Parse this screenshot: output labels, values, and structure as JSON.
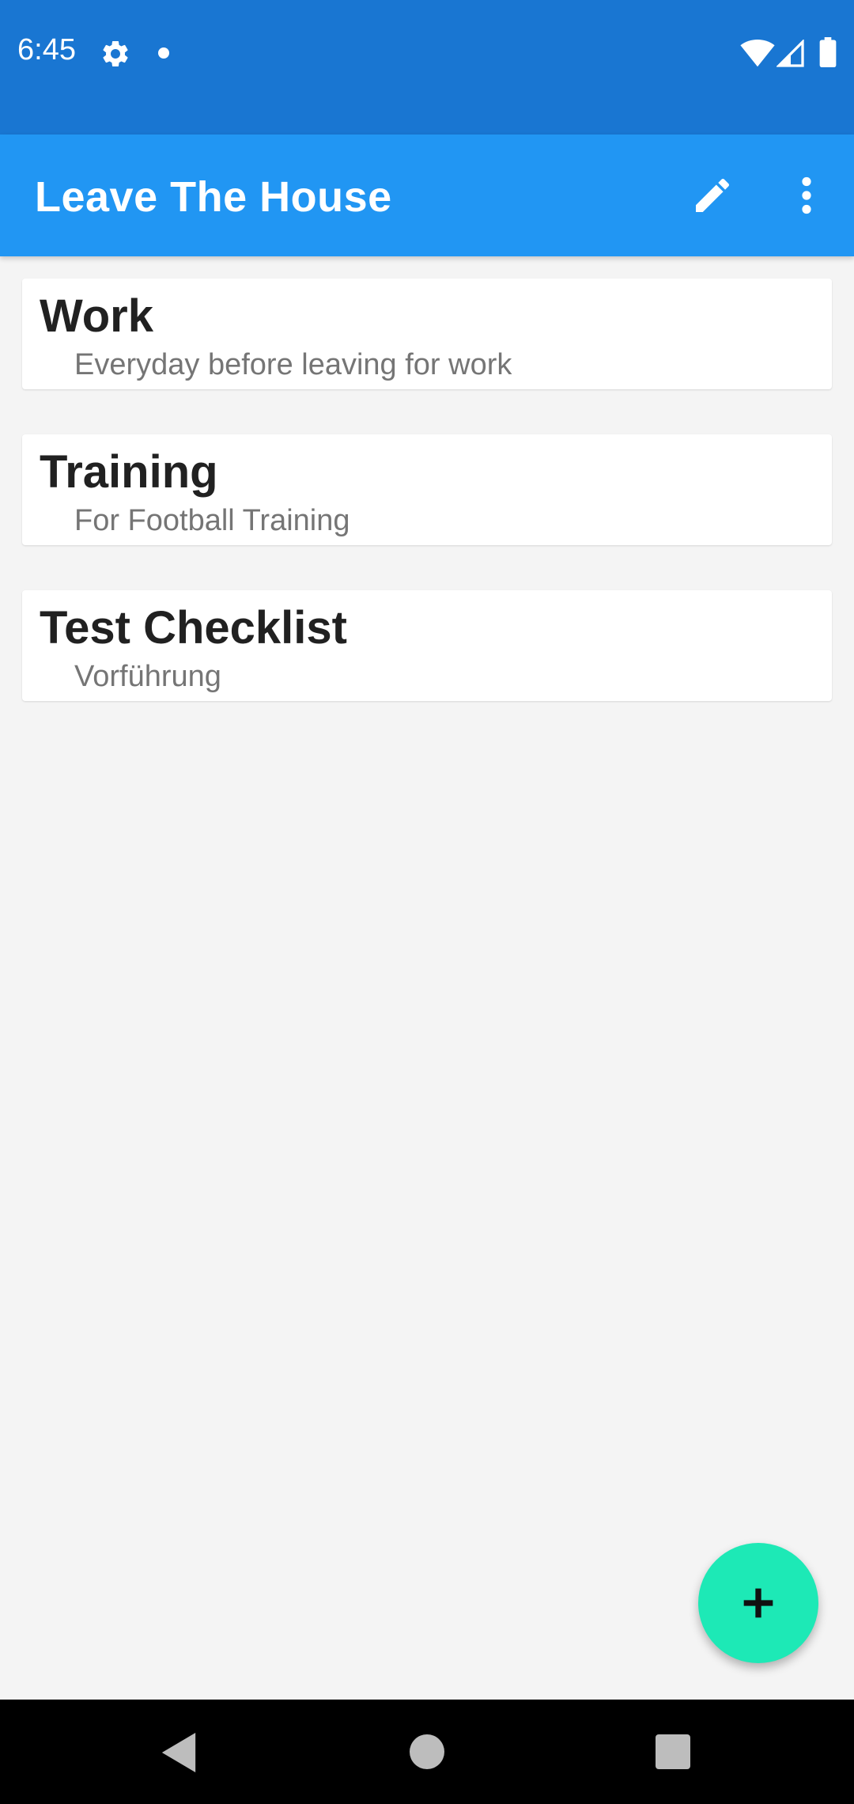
{
  "status_bar": {
    "time": "6:45",
    "icons": [
      "gear-icon",
      "dot-icon",
      "wifi-icon",
      "cell-signal-icon",
      "battery-icon"
    ]
  },
  "app_bar": {
    "title": "Leave The House",
    "actions": [
      "pencil-icon",
      "more-vert-icon"
    ],
    "color": "#2196f3"
  },
  "checklists": [
    {
      "title": "Work",
      "subtitle": "Everyday before leaving for work"
    },
    {
      "title": "Training",
      "subtitle": "For Football Training"
    },
    {
      "title": "Test Checklist",
      "subtitle": "Vorführung"
    }
  ],
  "fab": {
    "icon": "plus-icon",
    "color": "#1de9b6"
  },
  "nav_bar": {
    "icons": [
      "back-icon",
      "home-icon",
      "recents-icon"
    ]
  }
}
